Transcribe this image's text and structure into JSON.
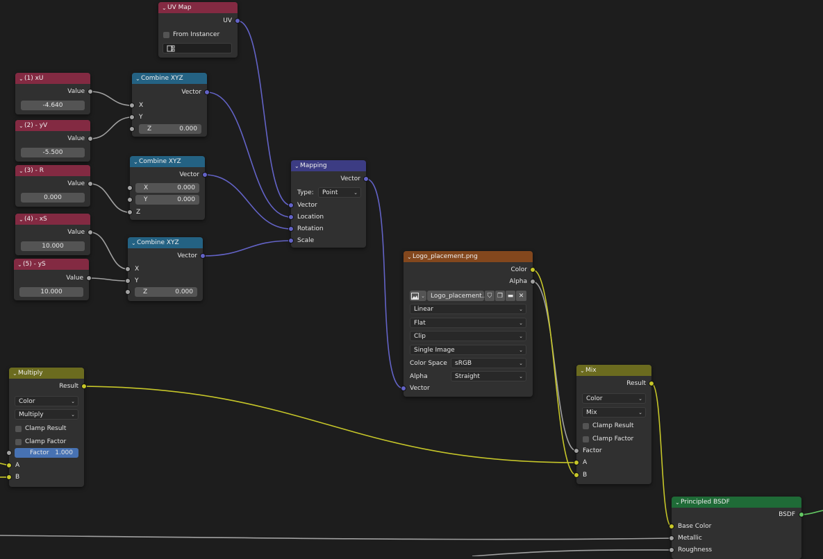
{
  "colors": {
    "background": "#1d1d1d",
    "node_body": "#303030",
    "header_value": "#832a42",
    "header_combine": "#246283",
    "header_mapping": "#3c3c83",
    "header_texture": "#83471d",
    "header_math": "#6b6b1f",
    "header_shader": "#1f6b37",
    "wire_vector": "#6363c7",
    "wire_float": "#a1a1a1",
    "wire_color": "#c7c729",
    "wire_shader": "#63c763"
  },
  "uvmap": {
    "title": "UV Map",
    "out_uv": "UV",
    "from_instancer": "From Instancer",
    "uv_field_icon": "uv-map-icon"
  },
  "v1": {
    "title": "(1) xU",
    "out": "Value",
    "value": "-4.640"
  },
  "v2": {
    "title": "(2) - yV",
    "out": "Value",
    "value": "-5.500"
  },
  "v3": {
    "title": "(3) - R",
    "out": "Value",
    "value": "0.000"
  },
  "v4": {
    "title": "(4) - xS",
    "out": "Value",
    "value": "10.000"
  },
  "v5": {
    "title": "(5) - yS",
    "out": "Value",
    "value": "10.000"
  },
  "c1": {
    "title": "Combine XYZ",
    "out": "Vector",
    "x": "X",
    "y": "Y",
    "z_label": "Z",
    "z_value": "0.000"
  },
  "c2": {
    "title": "Combine XYZ",
    "out": "Vector",
    "x_label": "X",
    "x_value": "0.000",
    "y_label": "Y",
    "y_value": "0.000",
    "z": "Z"
  },
  "c3": {
    "title": "Combine XYZ",
    "out": "Vector",
    "x": "X",
    "y": "Y",
    "z_label": "Z",
    "z_value": "0.000"
  },
  "mapping": {
    "title": "Mapping",
    "out": "Vector",
    "type_label": "Type:",
    "type_value": "Point",
    "in_vector": "Vector",
    "in_location": "Location",
    "in_rotation": "Rotation",
    "in_scale": "Scale"
  },
  "tex": {
    "title": "Logo_placement.png",
    "out_color": "Color",
    "out_alpha": "Alpha",
    "image_name": "Logo_placement...",
    "interpolation": "Linear",
    "projection": "Flat",
    "extension": "Clip",
    "source": "Single Image",
    "colorspace_label": "Color Space",
    "colorspace_value": "sRGB",
    "alpha_label": "Alpha",
    "alpha_value": "Straight",
    "in_vector": "Vector"
  },
  "multiply": {
    "title": "Multiply",
    "out": "Result",
    "data_type": "Color",
    "blend": "Multiply",
    "clamp_result": "Clamp Result",
    "clamp_factor": "Clamp Factor",
    "factor_label": "Factor",
    "factor_value": "1.000",
    "in_a": "A",
    "in_b": "B"
  },
  "mix": {
    "title": "Mix",
    "out": "Result",
    "data_type": "Color",
    "blend": "Mix",
    "clamp_result": "Clamp Result",
    "clamp_factor": "Clamp Factor",
    "in_factor": "Factor",
    "in_a": "A",
    "in_b": "B"
  },
  "bsdf": {
    "title": "Principled BSDF",
    "out": "BSDF",
    "in_base_color": "Base Color",
    "in_metallic": "Metallic",
    "in_roughness": "Roughness"
  }
}
